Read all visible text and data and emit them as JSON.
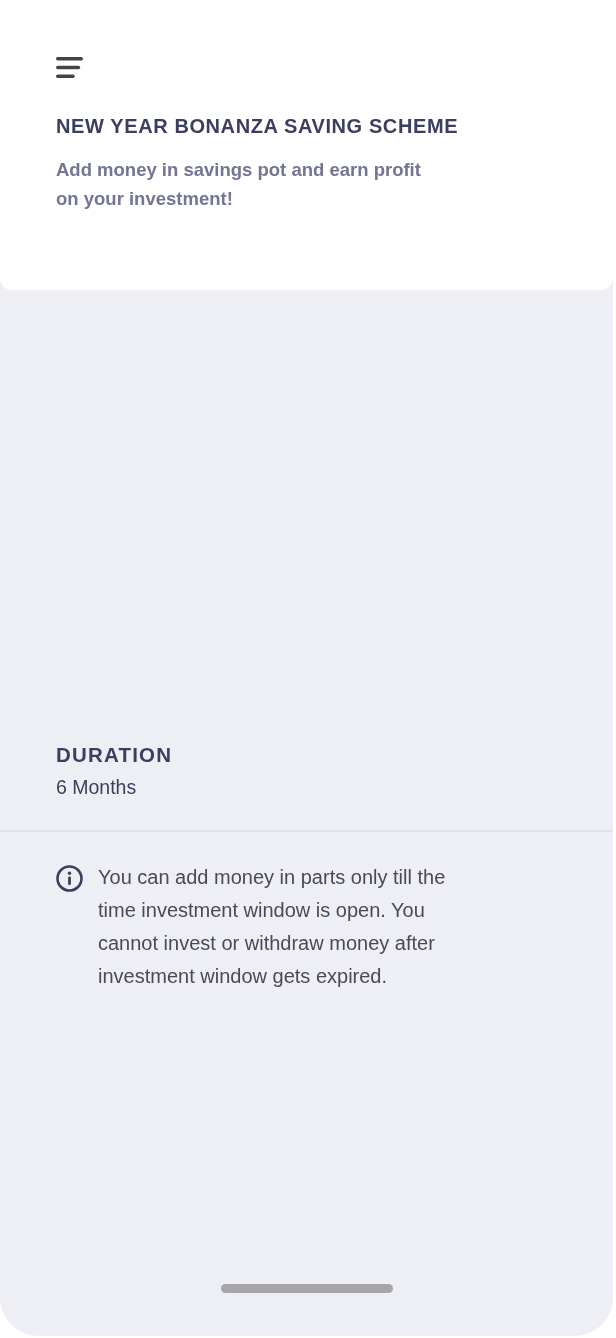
{
  "header": {
    "title": "NEW YEAR BONANZA SAVING SCHEME",
    "subtitle": "Add money in savings pot and earn profit on your investment!"
  },
  "duration": {
    "label": "DURATION",
    "value": "6 Months"
  },
  "notice": {
    "text": "You can add money in parts only till the time investment window is open. You cannot invest or withdraw money after investment window gets expired."
  }
}
